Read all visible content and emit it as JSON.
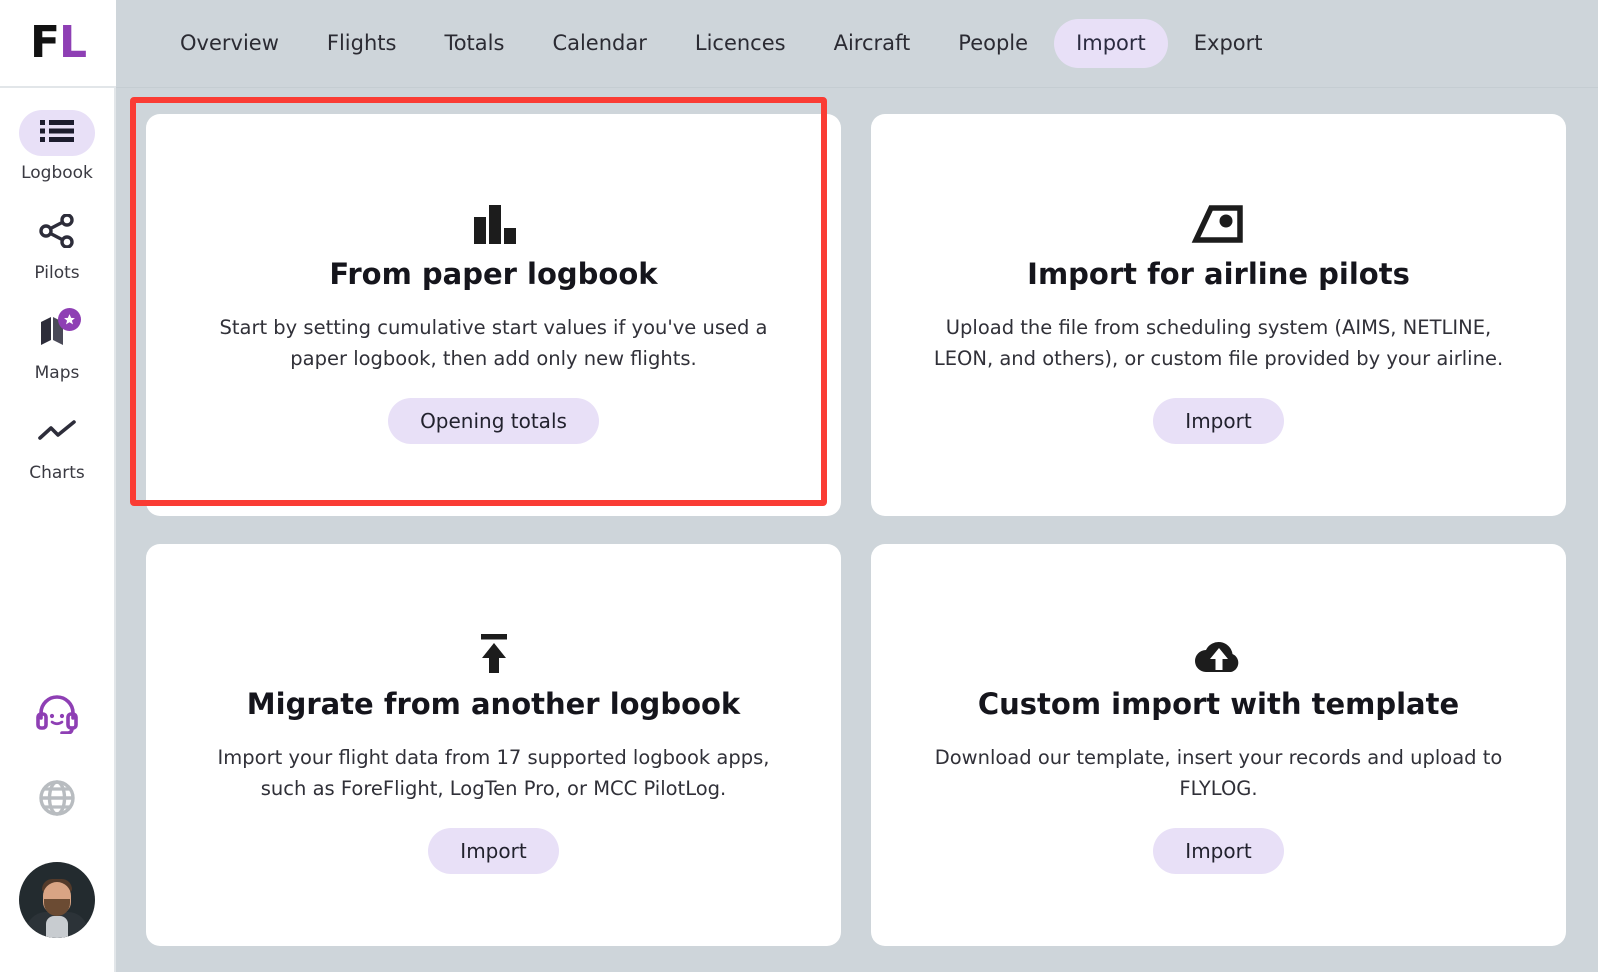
{
  "brand": {
    "logo_first": "F",
    "logo_second": "L",
    "accent_purple": "#8e3fb4",
    "pill_lavender": "#e8e0f7",
    "page_background": "#ced5da",
    "highlight_color": "#fa3c34"
  },
  "topnav": {
    "items": [
      {
        "label": "Overview",
        "active": false
      },
      {
        "label": "Flights",
        "active": false
      },
      {
        "label": "Totals",
        "active": false
      },
      {
        "label": "Calendar",
        "active": false
      },
      {
        "label": "Licences",
        "active": false
      },
      {
        "label": "Aircraft",
        "active": false
      },
      {
        "label": "People",
        "active": false
      },
      {
        "label": "Import",
        "active": true
      },
      {
        "label": "Export",
        "active": false
      }
    ]
  },
  "sidebar": {
    "items": [
      {
        "label": "Logbook",
        "icon": "list-icon",
        "active": true
      },
      {
        "label": "Pilots",
        "icon": "share-nodes-icon",
        "active": false
      },
      {
        "label": "Maps",
        "icon": "map-icon",
        "badge": "star-badge-icon",
        "active": false
      },
      {
        "label": "Charts",
        "icon": "line-chart-icon",
        "active": false
      }
    ],
    "bottom": [
      {
        "icon": "support-headset-icon"
      },
      {
        "icon": "globe-icon"
      },
      {
        "icon": "avatar"
      }
    ]
  },
  "cards": [
    {
      "icon": "bar-chart-icon",
      "title": "From paper logbook",
      "description": "Start by setting cumulative start values if you've used a paper logbook, then add only new flights.",
      "button": "Opening totals",
      "highlighted": true
    },
    {
      "icon": "airplane-tail-icon",
      "title": "Import for airline pilots",
      "description": "Upload the file from scheduling system (AIMS, NETLINE, LEON, and others), or custom file provided by your airline.",
      "button": "Import",
      "highlighted": false
    },
    {
      "icon": "upload-to-line-icon",
      "title": "Migrate from another logbook",
      "description": "Import your flight data from 17 supported logbook apps, such as ForeFlight, LogTen Pro, or MCC PilotLog.",
      "button": "Import",
      "highlighted": false
    },
    {
      "icon": "cloud-upload-icon",
      "title": "Custom import with template",
      "description": "Download our template, insert your records and upload to FLYLOG.",
      "button": "Import",
      "highlighted": false
    }
  ]
}
